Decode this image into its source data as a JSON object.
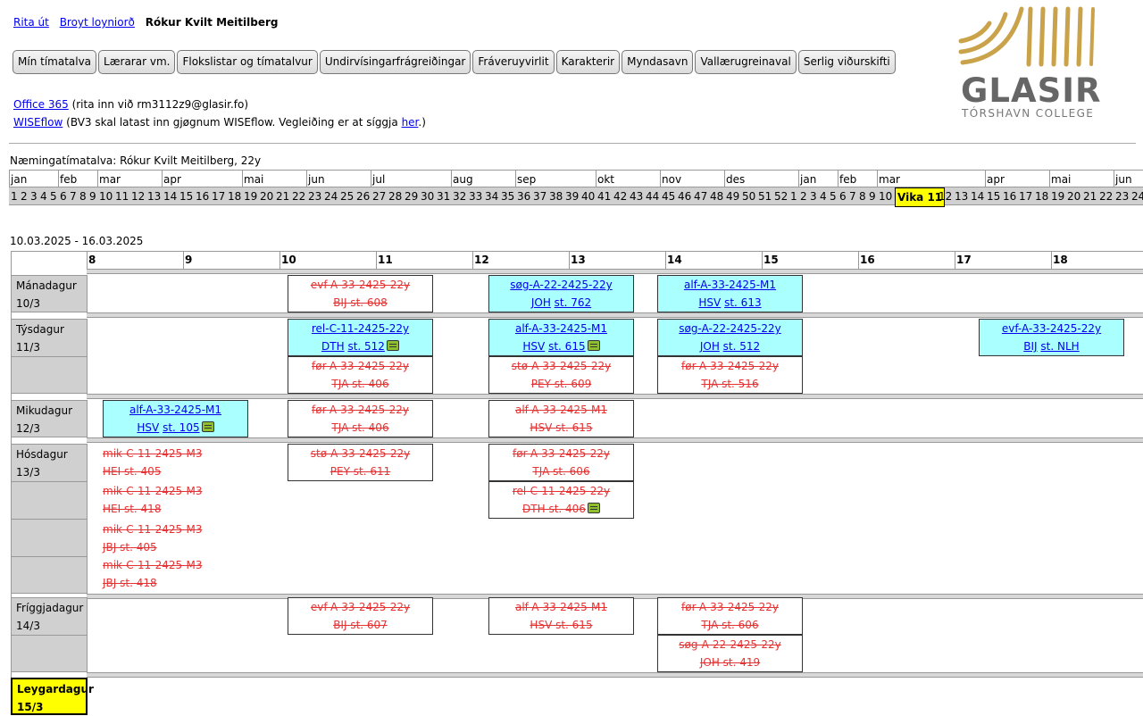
{
  "top": {
    "logout": "Rita út",
    "change_password": "Broyt loyniorð",
    "user_name": "Rókur Kvilt Meitilberg"
  },
  "nav": [
    "Mín tímatalva",
    "Lærarar vm.",
    "Flokslistar og tímatalvur",
    "Undirvísingarfrágreiðingar",
    "Fráveruyvirlit",
    "Karakterir",
    "Myndasavn",
    "Vallærugreinaval",
    "Serlig viðurskifti"
  ],
  "info": {
    "office_link": "Office 365",
    "office_text": " (rita inn við rm3112z9@glasir.fo)",
    "wiseflow_link": "WISEflow",
    "wiseflow_text": " (BV3 skal latast inn gjøgnum WISEflow. Vegleiðing er at síggja ",
    "wiseflow_here": "her",
    "wiseflow_end": ".)"
  },
  "logo": {
    "wordmark": "GLASIR",
    "subtitle": "TÓRSHAVN COLLEGE"
  },
  "timetable_title": "Næmingatímatalva: Rókur Kvilt Meitilberg, 22y",
  "months": [
    "jan",
    "feb",
    "mar",
    "apr",
    "mai",
    "jun",
    "jul",
    "aug",
    "sep",
    "okt",
    "nov",
    "des",
    "jan",
    "feb",
    "mar",
    "apr",
    "mai",
    "jun"
  ],
  "weeks": [
    "1",
    "2",
    "3",
    "4",
    "5",
    "6",
    "7",
    "8",
    "9",
    "10",
    "11",
    "12",
    "13",
    "14",
    "15",
    "16",
    "17",
    "18",
    "19",
    "20",
    "21",
    "22",
    "23",
    "24",
    "25",
    "26",
    "27",
    "28",
    "29",
    "30",
    "31",
    "32",
    "33",
    "34",
    "35",
    "36",
    "37",
    "38",
    "39",
    "40",
    "41",
    "42",
    "43",
    "44",
    "45",
    "46",
    "47",
    "48",
    "49",
    "50",
    "51",
    "52",
    "1",
    "2",
    "3",
    "4",
    "5",
    "6",
    "7",
    "8",
    "9",
    "10",
    "Vika 11",
    "12",
    "13",
    "14",
    "15",
    "16",
    "17",
    "18",
    "19",
    "20",
    "21",
    "22",
    "23",
    "24"
  ],
  "date_range": "10.03.2025 - 16.03.2025",
  "hours": [
    "8",
    "9",
    "10",
    "11",
    "12",
    "13",
    "14",
    "15",
    "16",
    "17",
    "18"
  ],
  "days": [
    {
      "name": "Mánadagur",
      "date": "10/3"
    },
    {
      "name": "Týsdagur",
      "date": "11/3"
    },
    {
      "name": "Mikudagur",
      "date": "12/3"
    },
    {
      "name": "Hósdagur",
      "date": "13/3"
    },
    {
      "name": "Fríggjadagur",
      "date": "14/3"
    },
    {
      "name": "Leygardagur",
      "date": "15/3"
    }
  ],
  "lessons": {
    "mon_1": {
      "course": "evf-A-33-2425-22y",
      "room": "BIJ st. 608"
    },
    "mon_2": {
      "course": "søg-A-22-2425-22y",
      "teacher": "JOH",
      "room": "st. 762"
    },
    "mon_3": {
      "course": "alf-A-33-2425-M1",
      "teacher": "HSV",
      "room": "st. 613"
    },
    "tue_1": {
      "course": "rel-C-11-2425-22y",
      "teacher": "DTH",
      "room": "st. 512"
    },
    "tue_2": {
      "course": "alf-A-33-2425-M1",
      "teacher": "HSV",
      "room": "st. 615"
    },
    "tue_3": {
      "course": "søg-A-22-2425-22y",
      "teacher": "JOH",
      "room": "st. 512"
    },
    "tue_4": {
      "course": "evf-A-33-2425-22y",
      "teacher": "BIJ",
      "room": "st. NLH"
    },
    "tue_5": {
      "course": "før-A-33-2425-22y",
      "room": "TJA st. 406"
    },
    "tue_6": {
      "course": "stø-A-33-2425-22y",
      "room": "PEY st. 609"
    },
    "tue_7": {
      "course": "før-A-33-2425-22y",
      "room": "TJA st. 516"
    },
    "wed_1": {
      "course": "alf-A-33-2425-M1",
      "teacher": "HSV",
      "room": "st. 105"
    },
    "wed_2": {
      "course": "før-A-33-2425-22y",
      "room": "TJA st. 406"
    },
    "wed_3": {
      "course": "alf-A-33-2425-M1",
      "room": "HSV st. 615"
    },
    "thu_1": {
      "course": "mik-C-11-2425-M3",
      "room": "HEI st. 405"
    },
    "thu_2": {
      "course": "mik-C-11-2425-M3",
      "room": "HEI st. 418"
    },
    "thu_3": {
      "course": "mik-C-11-2425-M3",
      "room": "JBJ st. 405"
    },
    "thu_4": {
      "course": "mik-C-11-2425-M3",
      "room": "JBJ st. 418"
    },
    "thu_5": {
      "course": "stø-A-33-2425-22y",
      "room": "PEY st. 611"
    },
    "thu_6": {
      "course": "før-A-33-2425-22y",
      "room": "TJA st. 606"
    },
    "thu_7": {
      "course": "rel-C-11-2425-22y",
      "room": "DTH st. 406"
    },
    "fri_1": {
      "course": "evf-A-33-2425-22y",
      "room": "BIJ st. 607"
    },
    "fri_2": {
      "course": "alf-A-33-2425-M1",
      "room": "HSV st. 615"
    },
    "fri_3": {
      "course": "før-A-33-2425-22y",
      "room": "TJA st. 606"
    },
    "fri_4": {
      "course": "søg-A-22-2425-22y",
      "room": "JOH st. 419"
    }
  },
  "colors": {
    "active_lesson": "#aaffff",
    "cancelled_text": "#e53333",
    "current_week": "#ffff00",
    "note_icon": "#8fbf2f"
  }
}
